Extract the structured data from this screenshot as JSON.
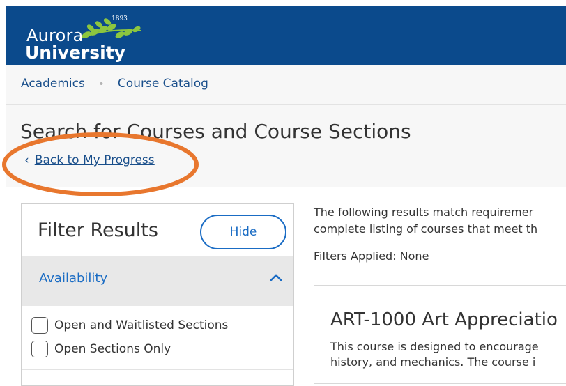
{
  "header": {
    "logo": {
      "line1": "Aurora",
      "line2": "University",
      "year": "1893"
    },
    "bg_color": "#0b4a8c"
  },
  "breadcrumb": {
    "item1": "Academics",
    "separator": "•",
    "item2": "Course Catalog"
  },
  "page": {
    "title": "Search for Courses and Course Sections",
    "back_link": "Back to My Progress",
    "back_chevron": "‹"
  },
  "filters": {
    "title": "Filter Results",
    "hide_label": "Hide",
    "section": {
      "label": "Availability",
      "expanded": true
    },
    "options": [
      {
        "label": "Open and Waitlisted Sections",
        "checked": false
      },
      {
        "label": "Open Sections Only",
        "checked": false
      }
    ]
  },
  "results": {
    "intro_line1": "The following results match requiremer",
    "intro_line2": "complete listing of courses that meet th",
    "filters_applied": "Filters Applied: None",
    "course": {
      "title": "ART-1000 Art Appreciatio",
      "desc_line1": "This course is designed to encourage",
      "desc_line2": "history, and mechanics. The course i"
    }
  },
  "annotation": {
    "color": "#e8772e",
    "shape": "ellipse-highlight"
  }
}
